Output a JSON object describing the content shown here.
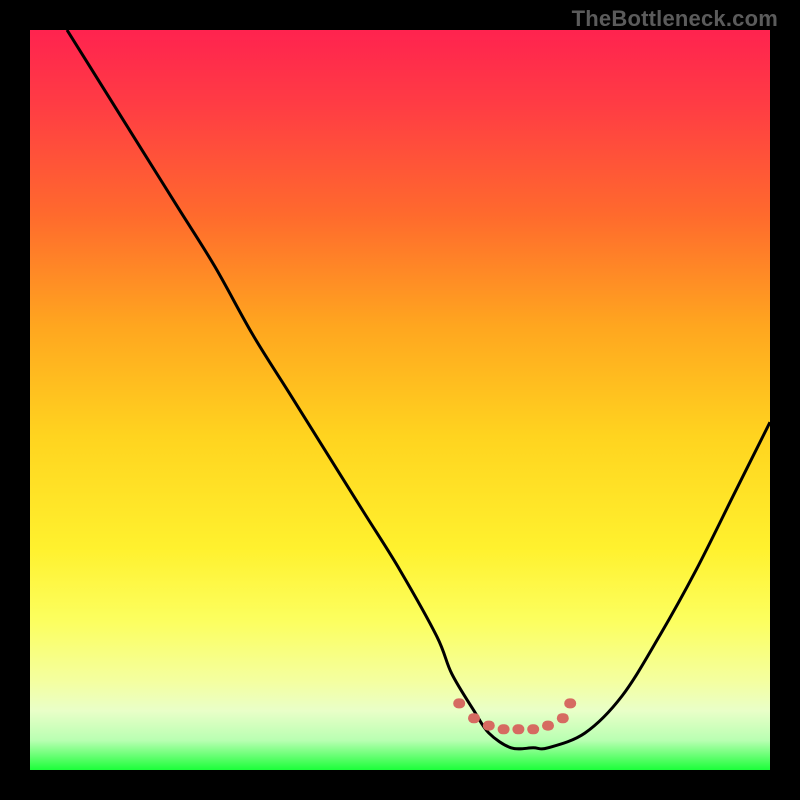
{
  "watermark": "TheBottleneck.com",
  "chart_data": {
    "type": "line",
    "title": "",
    "xlabel": "",
    "ylabel": "",
    "xlim": [
      0,
      100
    ],
    "ylim": [
      0,
      100
    ],
    "grid": false,
    "legend": false,
    "series": [
      {
        "name": "curve",
        "color": "#000000",
        "x": [
          5,
          10,
          15,
          20,
          25,
          30,
          35,
          40,
          45,
          50,
          55,
          57,
          60,
          62,
          65,
          68,
          70,
          75,
          80,
          85,
          90,
          95,
          100
        ],
        "y": [
          100,
          92,
          84,
          76,
          68,
          59,
          51,
          43,
          35,
          27,
          18,
          13,
          8,
          5,
          3,
          3,
          3,
          5,
          10,
          18,
          27,
          37,
          47
        ]
      }
    ],
    "markers": {
      "name": "bottleneck-band",
      "color": "#d66a61",
      "points": [
        {
          "x": 58,
          "y": 9
        },
        {
          "x": 60,
          "y": 7
        },
        {
          "x": 62,
          "y": 6
        },
        {
          "x": 64,
          "y": 5.5
        },
        {
          "x": 66,
          "y": 5.5
        },
        {
          "x": 68,
          "y": 5.5
        },
        {
          "x": 70,
          "y": 6
        },
        {
          "x": 72,
          "y": 7
        },
        {
          "x": 73,
          "y": 9
        }
      ]
    },
    "gradient_stops": [
      {
        "pos": 0,
        "color": "#ff234f"
      },
      {
        "pos": 10,
        "color": "#ff3c44"
      },
      {
        "pos": 25,
        "color": "#ff6a2d"
      },
      {
        "pos": 40,
        "color": "#ffa61f"
      },
      {
        "pos": 55,
        "color": "#ffd41f"
      },
      {
        "pos": 70,
        "color": "#fff12e"
      },
      {
        "pos": 80,
        "color": "#fcff60"
      },
      {
        "pos": 88,
        "color": "#f4ffa0"
      },
      {
        "pos": 92,
        "color": "#e9ffc8"
      },
      {
        "pos": 96,
        "color": "#b9ffb2"
      },
      {
        "pos": 100,
        "color": "#1cff3a"
      }
    ]
  }
}
